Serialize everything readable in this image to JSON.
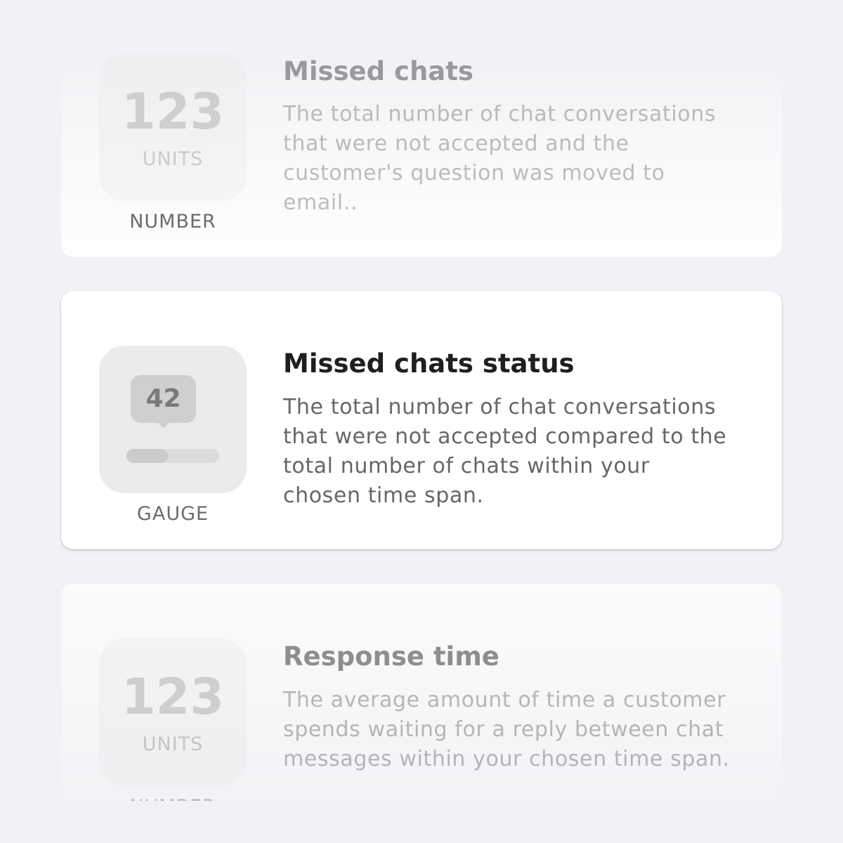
{
  "cards": [
    {
      "title": "Missed chats",
      "description": "The total number of chat conversations that were not accepted and the customer's question was moved to email..",
      "preview_type": "number",
      "preview_value": "123",
      "preview_unit": "UNITS",
      "type_label": "NUMBER"
    },
    {
      "title": "Missed chats status",
      "description": "The total number of chat conversations that were not accepted compared to the total number of chats within your chosen time span.",
      "preview_type": "gauge",
      "preview_value": "42",
      "gauge_fill_fraction": 0.45,
      "type_label": "GAUGE"
    },
    {
      "title": "Response time",
      "description": "The average amount of time a customer spends waiting for a reply between chat messages within your chosen time span.",
      "preview_type": "number",
      "preview_value": "123",
      "preview_unit": "UNITS",
      "type_label": "NUMBER"
    }
  ],
  "colors": {
    "background": "#f2f2f6",
    "card": "#ffffff",
    "preview_tile": "#ebebeb",
    "title_text": "#1f1f1f",
    "body_text": "#666666"
  }
}
